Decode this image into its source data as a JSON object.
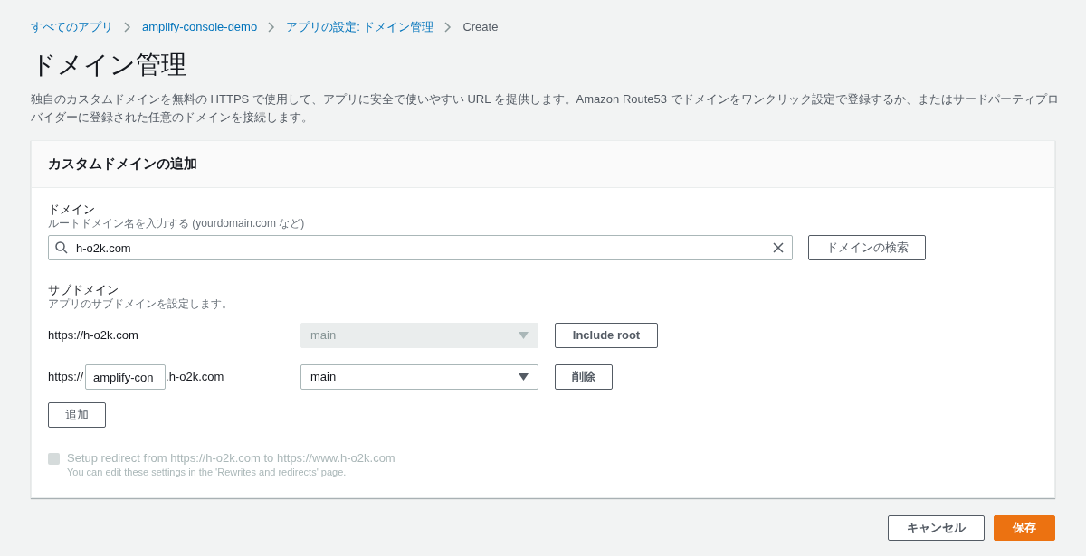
{
  "breadcrumbs": [
    {
      "label": "すべてのアプリ",
      "link": true
    },
    {
      "label": "amplify-console-demo",
      "link": true
    },
    {
      "label": "アプリの設定: ドメイン管理",
      "link": true
    },
    {
      "label": "Create",
      "link": false
    }
  ],
  "title": "ドメイン管理",
  "description": "独自のカスタムドメインを無料の HTTPS で使用して、アプリに安全で使いやすい URL を提供します。Amazon Route53 でドメインをワンクリック設定で登録するか、またはサードパーティプロバイダーに登録された任意のドメインを接続します。",
  "card": {
    "title": "カスタムドメインの追加",
    "domain": {
      "label": "ドメイン",
      "hint": "ルートドメイン名を入力する (yourdomain.com など)",
      "value": "h-o2k.com",
      "search_button": "ドメインの検索"
    },
    "subdomain": {
      "label": "サブドメイン",
      "hint": "アプリのサブドメインを設定します。",
      "rows": [
        {
          "kind": "root",
          "url": "https://h-o2k.com",
          "branch": "main",
          "disabled": true,
          "button": "Include root"
        },
        {
          "kind": "prefixed",
          "prefix": "https://",
          "value": "amplify-con",
          "suffix": ".h-o2k.com",
          "branch": "main",
          "disabled": false,
          "button": "削除"
        }
      ],
      "add_button": "追加"
    },
    "redirect": {
      "label": "Setup redirect from https://h-o2k.com to https://www.h-o2k.com",
      "hint": "You can edit these settings in the 'Rewrites and redirects' page.",
      "checked": false,
      "disabled": true
    }
  },
  "buttons": [
    {
      "label": "キャンセル",
      "kind": "secondary"
    },
    {
      "label": "保存",
      "kind": "primary"
    }
  ]
}
